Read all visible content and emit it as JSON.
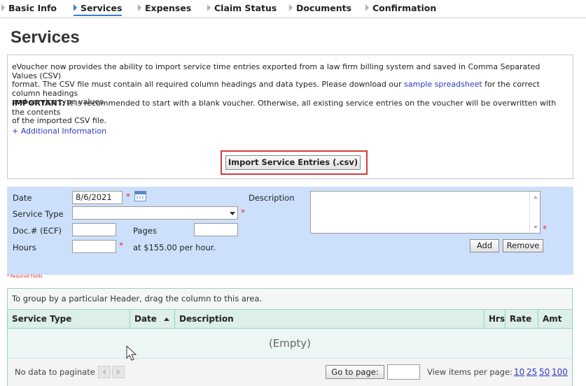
{
  "tabs": [
    "Basic Info",
    "Services",
    "Expenses",
    "Claim Status",
    "Documents",
    "Confirmation"
  ],
  "active_tab": "Services",
  "page_title": "Services",
  "info": {
    "para1_a": "eVoucher now provides the ability to import service time entries exported from a law firm billing system and saved in Comma Separated Values (CSV)",
    "para1_b": "format. The CSV file must contain all required column headings and data types. Please download our",
    "para1_link": "sample spreadsheet",
    "para1_c": "for the correct column headings",
    "para1_d": "and service type values.",
    "important_label": "IMPORTANT:",
    "important_a": "It is recommended to start with a blank voucher. Otherwise, all existing service entries on the voucher will be overwritten with the contents",
    "important_b": "of the imported CSV file.",
    "additional_link": "+ Additional Information",
    "import_button": "Import Service Entries (.csv)"
  },
  "form": {
    "date_label": "Date",
    "date_value": "8/6/2021",
    "service_type_label": "Service Type",
    "service_type_value": "",
    "doc_label": "Doc.# (ECF)",
    "doc_value": "",
    "pages_label": "Pages",
    "pages_value": "",
    "hours_label": "Hours",
    "hours_value": "",
    "rate_text": "at $155.00 per hour.",
    "description_label": "Description",
    "description_value": "",
    "required_mark": "*",
    "add_button": "Add",
    "remove_button": "Remove",
    "required_note": "* Required Fields"
  },
  "grid": {
    "group_hint": "To group by a particular Header, drag the column to this area.",
    "columns": [
      "Service Type",
      "Date",
      "Description",
      "Hrs",
      "Rate",
      "Amt"
    ],
    "empty_text": "(Empty)",
    "no_data_text": "No data to paginate",
    "goto_button": "Go to page:",
    "goto_value": "",
    "items_per_page_label": "View items per page:",
    "page_sizes": [
      "10",
      "25",
      "50",
      "100"
    ]
  },
  "colors": {
    "form_bg": "#cde0fb",
    "highlight_border": "#d63a3a",
    "link": "#2c3bbd",
    "grid_header_bg": "#dcefe9",
    "required": "#e03030"
  },
  "icons": [
    "tab-arrow-icon",
    "calendar-icon",
    "dropdown-arrow-icon",
    "sort-asc-icon",
    "prev-page-icon",
    "next-page-icon",
    "mouse-cursor-icon"
  ]
}
